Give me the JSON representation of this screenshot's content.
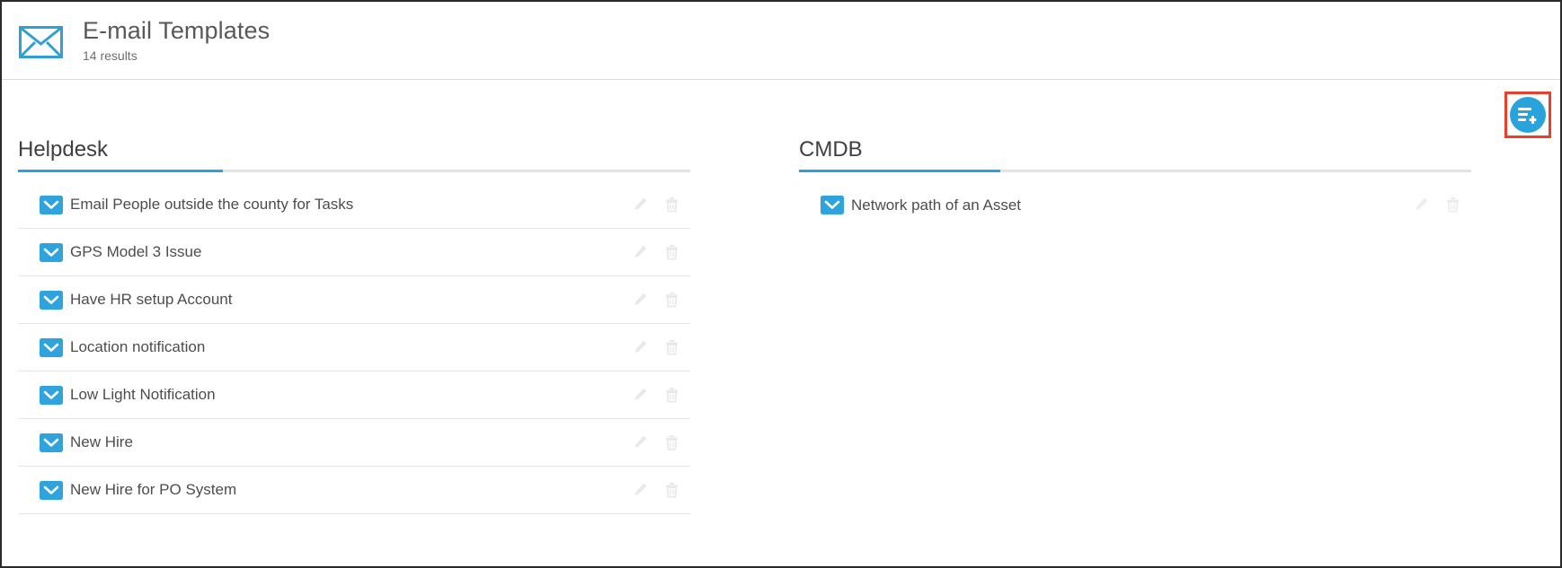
{
  "header": {
    "icon": "envelope-outline-icon",
    "title": "E-mail Templates",
    "results": "14 results"
  },
  "toolbar": {
    "add_button": {
      "icon": "add-template-icon",
      "label": "",
      "highlighted": true,
      "highlight_color": "#e8402a",
      "color": "#29a3dc"
    }
  },
  "colors": {
    "accent": "#29a3dc",
    "title_text": "#58595b",
    "row_text": "#4d4d4d",
    "divider": "#e6e6e6",
    "highlight": "#e8402a"
  },
  "columns": [
    {
      "section_title": "Helpdesk",
      "underline_width": 228,
      "row_action_edit": "pencil-icon",
      "row_action_delete": "trash-icon",
      "items": [
        {
          "icon": "envelope-icon",
          "label": "Email People outside the county for Tasks"
        },
        {
          "icon": "envelope-icon",
          "label": "GPS Model 3 Issue"
        },
        {
          "icon": "envelope-icon",
          "label": "Have HR setup Account"
        },
        {
          "icon": "envelope-icon",
          "label": "Location notification"
        },
        {
          "icon": "envelope-icon",
          "label": "Low Light Notification"
        },
        {
          "icon": "envelope-icon",
          "label": "New Hire"
        },
        {
          "icon": "envelope-icon",
          "label": "New Hire for PO System"
        }
      ]
    },
    {
      "section_title": "CMDB",
      "underline_width": 224,
      "row_action_edit": "pencil-icon",
      "row_action_delete": "trash-icon",
      "items": [
        {
          "icon": "envelope-icon",
          "label": "Network path of an Asset"
        }
      ]
    }
  ]
}
